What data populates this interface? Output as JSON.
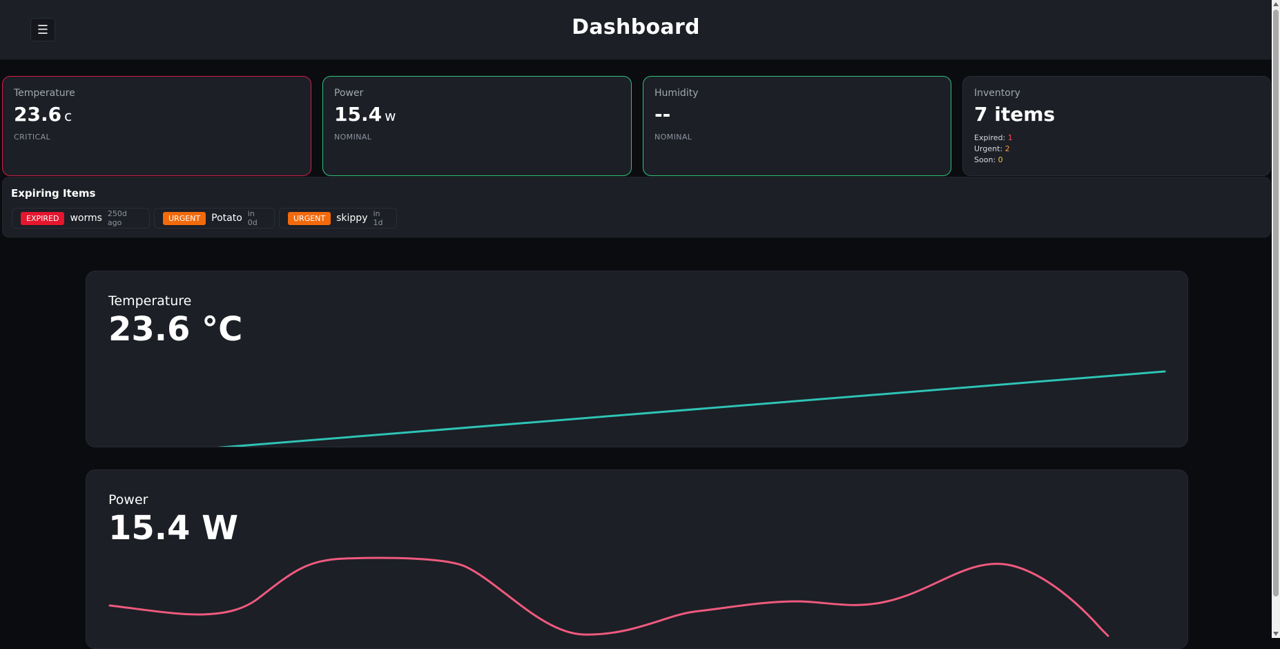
{
  "header": {
    "menu_icon": "☰",
    "title": "Dashboard"
  },
  "cards": [
    {
      "label": "Temperature",
      "value": "23.6",
      "unit": "c",
      "status": "CRITICAL",
      "status_color": "#d21f46"
    },
    {
      "label": "Power",
      "value": "15.4",
      "unit": "w",
      "status": "NOMINAL",
      "status_color": "#2fc47f"
    },
    {
      "label": "Humidity",
      "value": "--",
      "unit": "",
      "status": "NOMINAL",
      "status_color": "#2fc47f"
    }
  ],
  "inventory": {
    "label": "Inventory",
    "value": "7 items",
    "expired_label": "Expired:",
    "expired_count": "1",
    "urgent_label": "Urgent:",
    "urgent_count": "2",
    "soon_label": "Soon:",
    "soon_count": "0"
  },
  "expiring": {
    "title": "Expiring Items",
    "items": [
      {
        "badge": "EXPIRED",
        "name": "worms",
        "when": "250d ago"
      },
      {
        "badge": "URGENT",
        "name": "Potato",
        "when": "in 0d"
      },
      {
        "badge": "URGENT",
        "name": "skippy",
        "when": "in 1d"
      }
    ]
  },
  "charts": {
    "temperature": {
      "title": "Temperature",
      "value": "23.6 °C",
      "color": "#2ec4b6"
    },
    "power": {
      "title": "Power",
      "value": "15.4 W",
      "color": "#f05a7e"
    }
  }
}
